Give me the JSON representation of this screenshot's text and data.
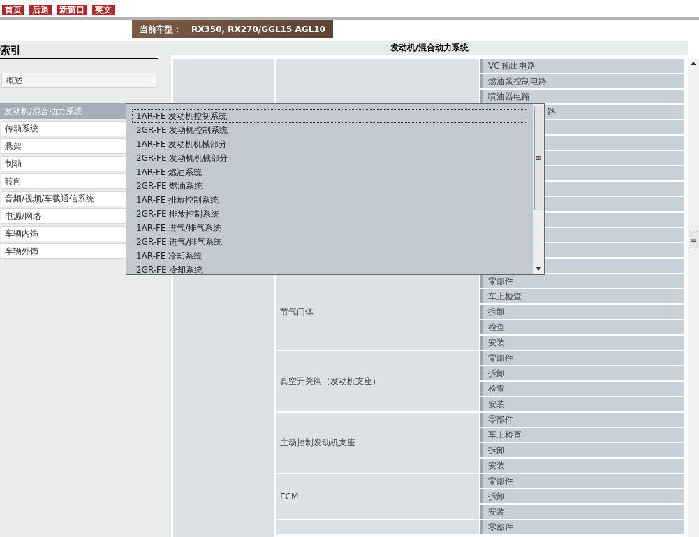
{
  "top_nav": [
    {
      "label": "首页"
    },
    {
      "label": "后退"
    },
    {
      "label": "新窗口"
    },
    {
      "label": "英文"
    }
  ],
  "model_banner": {
    "label": "当前车型：",
    "value": "RX350, RX270/GGL15 AGL10"
  },
  "sidebar": {
    "title": "索引",
    "overview": "概述",
    "items": [
      {
        "label": "发动机/混合动力系统",
        "selected": true
      },
      {
        "label": "传动系统",
        "selected": false
      },
      {
        "label": "悬架",
        "selected": false
      },
      {
        "label": "制动",
        "selected": false
      },
      {
        "label": "转向",
        "selected": false
      },
      {
        "label": "音频/视频/车载通信系统",
        "selected": false
      },
      {
        "label": "电源/网络",
        "selected": false
      },
      {
        "label": "车辆内饰",
        "selected": false
      },
      {
        "label": "车辆外饰",
        "selected": false
      }
    ]
  },
  "section_title": "发动机/混合动力系统",
  "groups": [
    {
      "items": [
        {
          "kind": "text",
          "label": "VC 输出电路"
        },
        {
          "kind": "text",
          "label": "燃油泵控制电路"
        },
        {
          "kind": "text",
          "label": "喷油器电路"
        },
        {
          "kind": "covered",
          "label": "路"
        },
        {
          "kind": "blank"
        },
        {
          "kind": "blank"
        },
        {
          "kind": "blank"
        },
        {
          "kind": "blank"
        },
        {
          "kind": "blank"
        },
        {
          "kind": "blank"
        },
        {
          "kind": "blank"
        },
        {
          "kind": "blank"
        },
        {
          "kind": "blank"
        },
        {
          "kind": "blank"
        }
      ]
    },
    {
      "name": "节气门体",
      "items": [
        {
          "kind": "text",
          "label": "零部件"
        },
        {
          "kind": "text",
          "label": "车上检查"
        },
        {
          "kind": "text",
          "label": "拆卸"
        },
        {
          "kind": "text",
          "label": "检查"
        },
        {
          "kind": "text",
          "label": "安装"
        }
      ]
    },
    {
      "name": "真空开关阀（发动机支座）",
      "items": [
        {
          "kind": "text",
          "label": "零部件"
        },
        {
          "kind": "text",
          "label": "拆卸"
        },
        {
          "kind": "text",
          "label": "检查"
        },
        {
          "kind": "text",
          "label": "安装"
        }
      ]
    },
    {
      "name": "主动控制发动机支座",
      "items": [
        {
          "kind": "text",
          "label": "零部件"
        },
        {
          "kind": "text",
          "label": "车上检查"
        },
        {
          "kind": "text",
          "label": "拆卸"
        },
        {
          "kind": "text",
          "label": "安装"
        }
      ]
    },
    {
      "name": "ECM",
      "items": [
        {
          "kind": "text",
          "label": "零部件"
        },
        {
          "kind": "text",
          "label": "拆卸"
        },
        {
          "kind": "text",
          "label": "安装"
        }
      ]
    },
    {
      "items": [
        {
          "kind": "text",
          "label": "零部件"
        }
      ]
    }
  ],
  "dropdown": {
    "options": [
      {
        "label": "1AR-FE 发动机控制系统",
        "selected": true
      },
      {
        "label": "2GR-FE 发动机控制系统",
        "selected": false
      },
      {
        "label": "1AR-FE 发动机机械部分",
        "selected": false
      },
      {
        "label": "2GR-FE 发动机机械部分",
        "selected": false
      },
      {
        "label": "1AR-FE 燃油系统",
        "selected": false
      },
      {
        "label": "2GR-FE 燃油系统",
        "selected": false
      },
      {
        "label": "1AR-FE 排放控制系统",
        "selected": false
      },
      {
        "label": "2GR-FE 排放控制系统",
        "selected": false
      },
      {
        "label": "1AR-FE 进气/排气系统",
        "selected": false
      },
      {
        "label": "2GR-FE 进气/排气系统",
        "selected": false
      },
      {
        "label": "1AR-FE 冷却系统",
        "selected": false
      },
      {
        "label": "2GR-FE 冷却系统",
        "selected": false
      }
    ]
  }
}
